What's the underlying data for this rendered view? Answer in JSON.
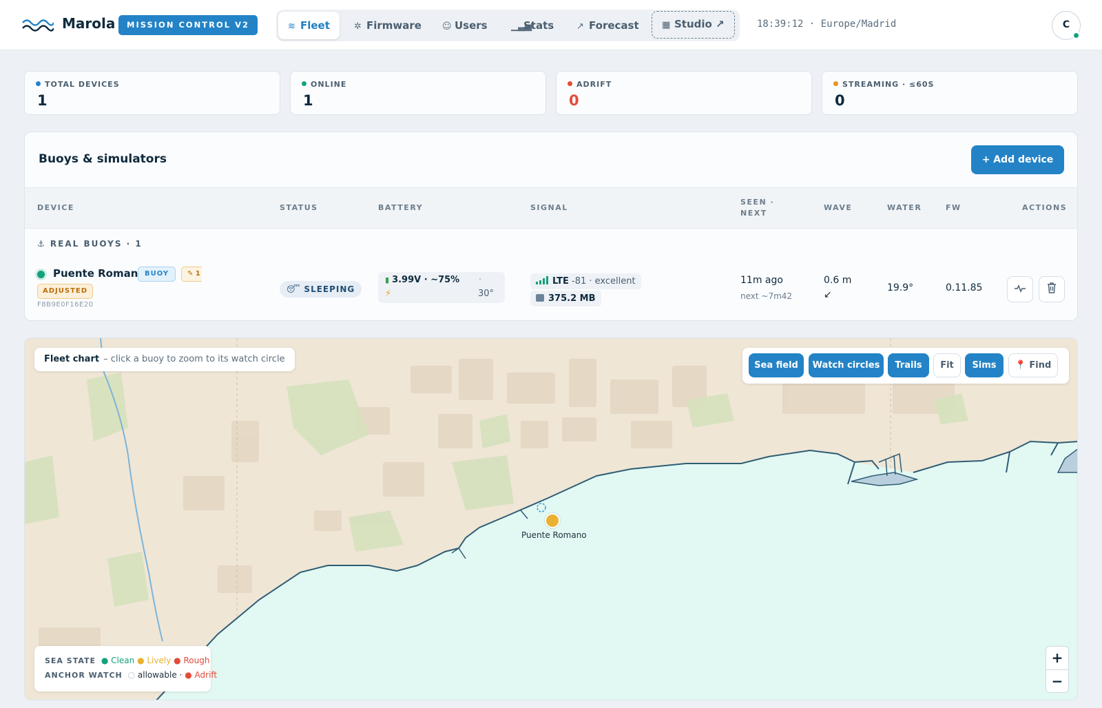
{
  "app": {
    "brand": "Marola",
    "badge": "MISSION CONTROL V2",
    "clock": "18:39:12 · Europe/Madrid",
    "avatar_initial": "C",
    "accent": "#2383c6"
  },
  "nav": {
    "tabs": [
      {
        "label": "Fleet",
        "icon": "fleet-icon",
        "active": true
      },
      {
        "label": "Firmware",
        "icon": "chip-icon"
      },
      {
        "label": "Users",
        "icon": "users-icon"
      },
      {
        "label": "Stats",
        "icon": "bar-chart-icon"
      },
      {
        "label": "Forecast",
        "icon": "trend-icon"
      },
      {
        "label": "Studio ↗",
        "icon": "grid-icon",
        "external": true
      }
    ]
  },
  "stats": [
    {
      "label": "TOTAL DEVICES",
      "value": "1",
      "color": "#2383c6"
    },
    {
      "label": "ONLINE",
      "value": "1",
      "color": "#13a27c"
    },
    {
      "label": "ADRIFT",
      "value": "0",
      "color": "#e24c3a"
    },
    {
      "label": "STREAMING · ≤60S",
      "value": "0",
      "color": "#e8941c"
    }
  ],
  "panel": {
    "title": "Buoys & simulators",
    "add_button": "+ Add device",
    "columns": {
      "device": "DEVICE",
      "status": "STATUS",
      "battery": "BATTERY",
      "signal": "SIGNAL",
      "seen": "SEEN ·",
      "next": "NEXT",
      "wave": "WAVE",
      "water": "WATER",
      "fw": "FW",
      "actions": "ACTIONS"
    },
    "group_label": "⚓ REAL BUOYS · 1",
    "device": {
      "name": "Puente Romano",
      "tag_type": "BUOY",
      "tag_edit": "✎ 1",
      "tag_adjusted": "ADJUSTED",
      "id": "F8B9E0F16E20",
      "status": "😴 SLEEPING",
      "battery_main": "3.99V · ~75%",
      "battery_sep": "·",
      "battery_temp": "30°",
      "signal_tech": "LTE",
      "signal_detail": "-81 · excellent",
      "data_used": "375.2 MB",
      "seen": "11m ago",
      "next": "next ~7m42",
      "wave_height": "0.6 m",
      "wave_dir": "↙",
      "water_temp": "19.9°",
      "firmware": "0.11.85"
    }
  },
  "map": {
    "title": "Fleet chart",
    "hint": "– click a buoy to zoom to its watch circle",
    "controls": [
      {
        "label": "Sea field",
        "on": true
      },
      {
        "label": "Watch circles",
        "on": true
      },
      {
        "label": "Trails",
        "on": true
      },
      {
        "label": "Fit",
        "on": false
      },
      {
        "label": "Sims",
        "on": true
      },
      {
        "label": "📍 Find",
        "on": false
      }
    ],
    "buoy_label": "Puente Romano",
    "legend": {
      "sea_state_title": "SEA STATE",
      "clean": "Clean",
      "lively": "Lively",
      "rough": "Rough",
      "anchor_title": "ANCHOR WATCH",
      "allowable": "allowable ·",
      "adrift": "Adrift"
    },
    "zoom_in": "+",
    "zoom_out": "−"
  }
}
